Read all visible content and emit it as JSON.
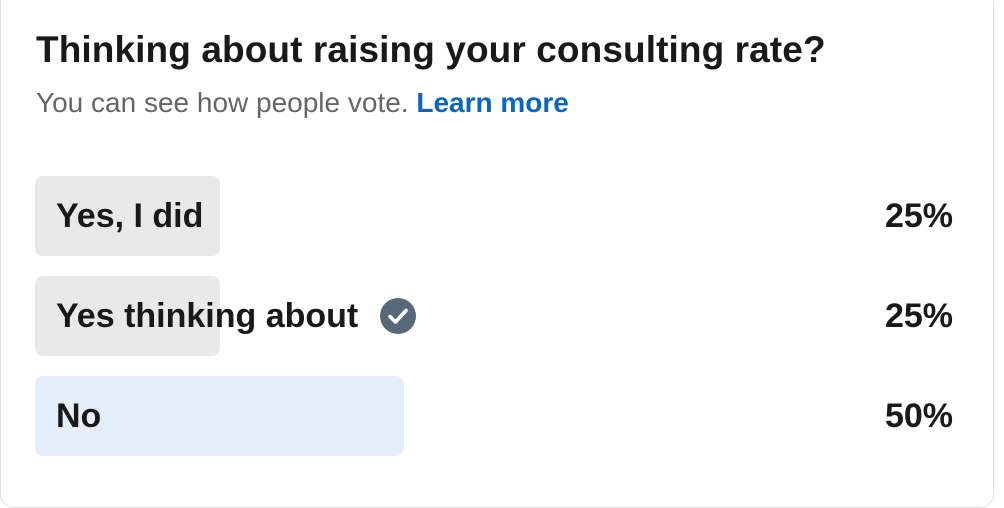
{
  "poll": {
    "title": "Thinking about raising your consulting rate?",
    "subtitle": "You can see how people vote.",
    "learn_more": "Learn more",
    "options": [
      {
        "label": "Yes, I did",
        "percent_text": "25%",
        "share": 0.25,
        "selected": false
      },
      {
        "label": "Yes thinking about",
        "percent_text": "25%",
        "share": 0.25,
        "selected": true
      },
      {
        "label": "No",
        "percent_text": "50%",
        "share": 0.5,
        "selected": false
      }
    ]
  },
  "colors": {
    "bar": "#e9e9e9",
    "winning_bar": "#e3eefa",
    "link": "#0a66c2",
    "check_badge": "#56687a"
  },
  "icons": {
    "selected_vote": "check-circle-icon"
  }
}
